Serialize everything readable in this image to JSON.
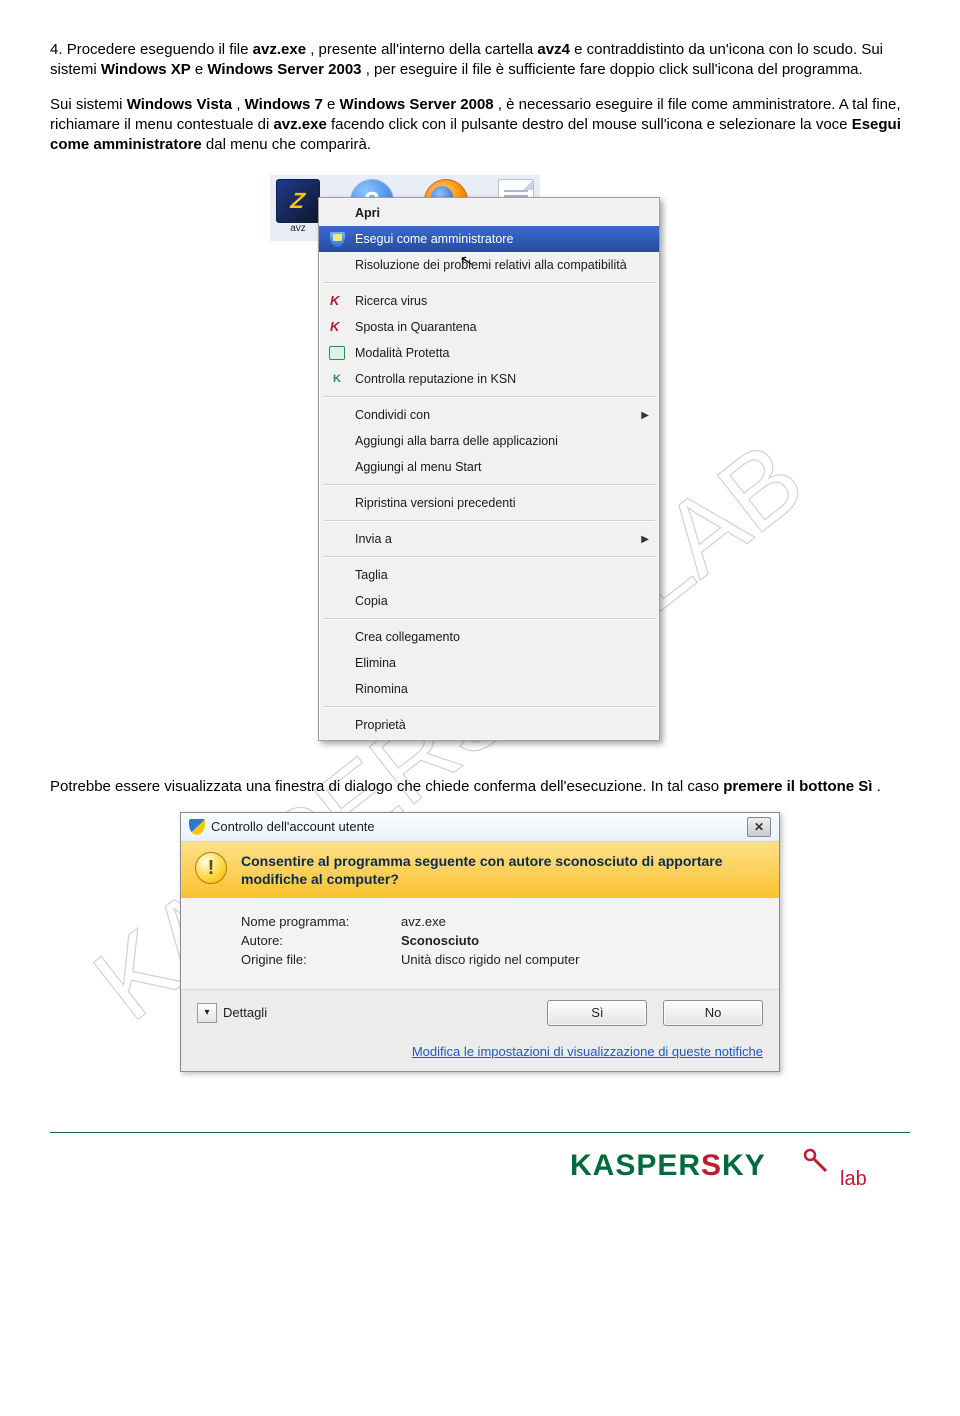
{
  "p1": {
    "num": " 4.  ",
    "a": "Procedere eseguendo il file ",
    "avzexe": "avz.exe",
    "b": ", presente all'interno della cartella ",
    "avz4": "avz4",
    "c": " e contraddistinto da un'icona con lo scudo. Sui sistemi ",
    "wxp": "Windows XP",
    "d": " e ",
    "w2003": "Windows Server 2003",
    "e": ", per eseguire il file è sufficiente fare doppio click sull'icona del programma."
  },
  "p2": {
    "a": " Sui sistemi ",
    "wv": "Windows Vista",
    "b": ", ",
    "w7": "Windows 7",
    "c": " e ",
    "w2008": "Windows Server 2008",
    "d": ", è necessario eseguire il file come amministratore. A tal fine, richiamare il menu contestuale di ",
    "avzexe": "avz.exe",
    "e": " facendo click con il pulsante destro del mouse sull'icona e selezionare la voce ",
    "eca": "Esegui come amministratore",
    "f": " dal menu che comparirà."
  },
  "desktop": {
    "avz_label": "avz"
  },
  "menu": {
    "apri": "Apri",
    "esegui_admin": "Esegui come amministratore",
    "compat": "Risoluzione dei problemi relativi alla compatibilità",
    "ricerca": "Ricerca virus",
    "quarantena": "Sposta in Quarantena",
    "protetta": "Modalità Protetta",
    "ksn": "Controlla reputazione in KSN",
    "condividi": "Condividi con",
    "taskbar": "Aggiungi alla barra delle applicazioni",
    "startmenu": "Aggiungi al menu Start",
    "ripristina": "Ripristina versioni precedenti",
    "invia": "Invia a",
    "taglia": "Taglia",
    "copia": "Copia",
    "collegamento": "Crea collegamento",
    "elimina": "Elimina",
    "rinomina": "Rinomina",
    "proprieta": "Proprietà"
  },
  "p3": {
    "a": "Potrebbe essere visualizzata una finestra di dialogo che chiede conferma dell'esecuzione. In tal caso ",
    "b": "premere il bottone Sì",
    "c": "."
  },
  "uac": {
    "title": "Controllo dell'account utente",
    "question": "Consentire al programma seguente con autore sconosciuto di apportare modifiche al computer?",
    "k_prog": "Nome programma:",
    "v_prog": "avz.exe",
    "k_auth": "Autore:",
    "v_auth": "Sconosciuto",
    "k_orig": "Origine file:",
    "v_orig": "Unità disco rigido nel computer",
    "details": "Dettagli",
    "yes": "Sì",
    "no": "No",
    "link": "Modifica le impostazioni di visualizzazione di queste notifiche"
  },
  "watermark": "KASPERSKY LAB",
  "brand": "KASPERSKY"
}
